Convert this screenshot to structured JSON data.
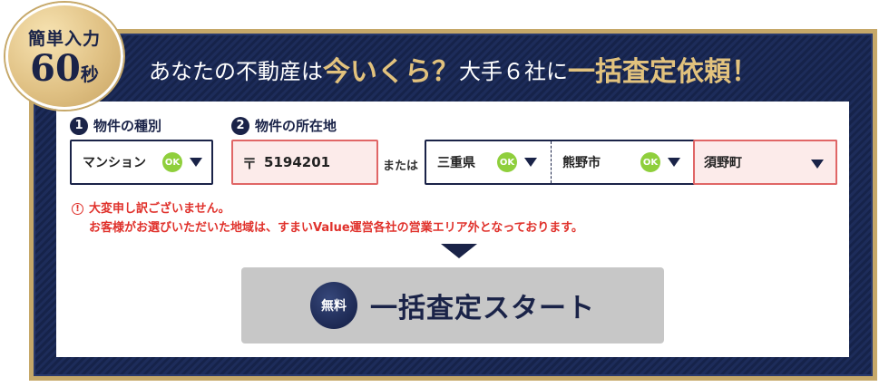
{
  "badge": {
    "top": "簡単入力",
    "number": "60",
    "unit": "秒"
  },
  "headline": {
    "part1": "あなたの不動産は",
    "part2": "今いくら？",
    "part3": "大手６社に",
    "part4": "一括査定依頼！"
  },
  "step1": {
    "number": "1",
    "label": "物件の種別"
  },
  "step2": {
    "number": "2",
    "label": "物件の所在地"
  },
  "property_type": {
    "value": "マンション",
    "status": "OK",
    "icon": "chevron-down-icon"
  },
  "zip": {
    "mark": "〒",
    "value": "5194201"
  },
  "or_label": "または",
  "prefecture": {
    "value": "三重県",
    "status": "OK"
  },
  "city": {
    "value": "熊野市",
    "status": "OK"
  },
  "town": {
    "value": "須野町"
  },
  "error": {
    "icon": "!",
    "line1": "大変申し訳ございません。",
    "line2": "お客様がお選びいただいた地域は、すまいValue運営各社の営業エリア外となっております。"
  },
  "start_button": {
    "badge": "無料",
    "label": "一括査定スタート"
  },
  "colors": {
    "navy": "#1a2348",
    "gold": "#c6a869",
    "error": "#e0312b",
    "ok": "#8fcf3c"
  }
}
